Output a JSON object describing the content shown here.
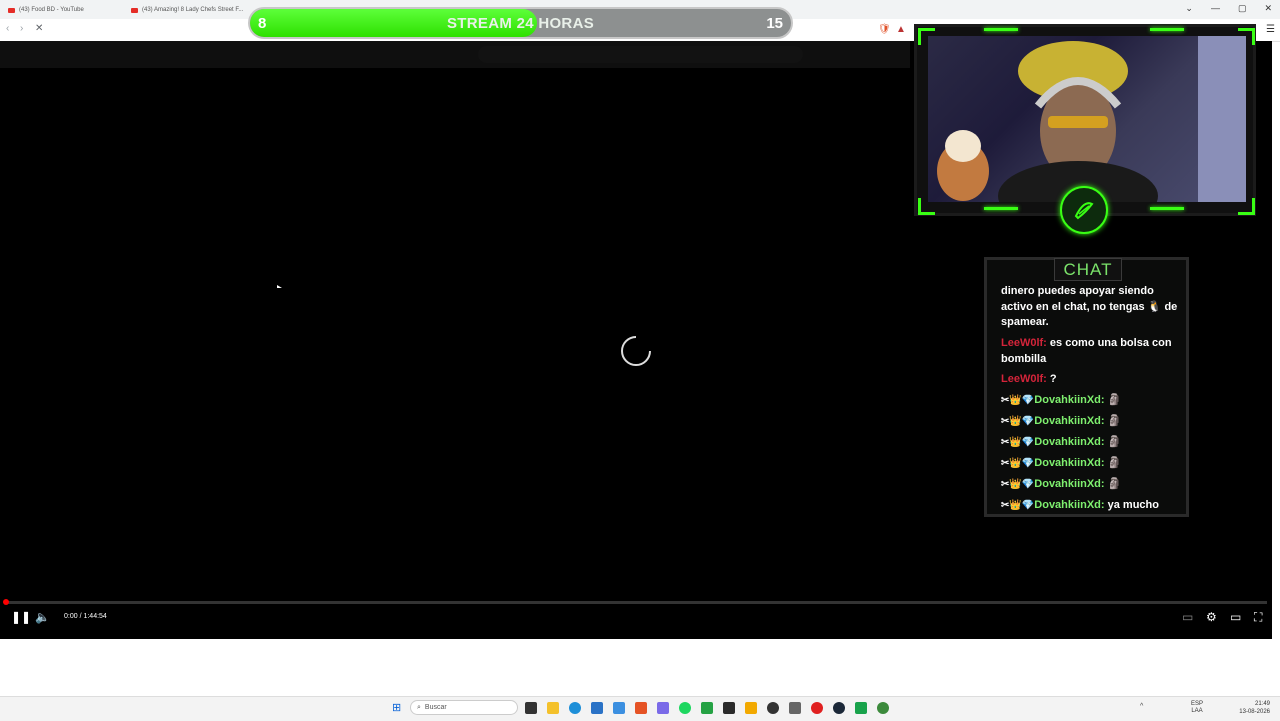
{
  "browser": {
    "tabs": [
      "(43) Food BD - YouTube",
      "(43) Amazing! 8 Lady Chefs Street F..."
    ],
    "window_controls": [
      "⌄",
      "—",
      "▢",
      "✕"
    ]
  },
  "stream_bar": {
    "left_number": "8",
    "title": "STREAM 24 HORAS",
    "right_number": "15",
    "progress_fraction": 0.53
  },
  "chat": {
    "header": "CHAT",
    "messages": [
      {
        "user": "",
        "text": "dinero puedes apoyar siendo activo en el chat, no tengas 🐧 de spamear."
      },
      {
        "user": "LeeW0lf:",
        "text": "es como una bolsa con bombilla",
        "color": "red"
      },
      {
        "user": "LeeW0lf:",
        "text": "?",
        "color": "red"
      },
      {
        "user": "DovahkiinXd:",
        "badges": "✂👑💎",
        "text": "🗿",
        "color": "green"
      },
      {
        "user": "DovahkiinXd:",
        "badges": "✂👑💎",
        "text": "🗿",
        "color": "green"
      },
      {
        "user": "DovahkiinXd:",
        "badges": "✂👑💎",
        "text": "🗿",
        "color": "green"
      },
      {
        "user": "DovahkiinXd:",
        "badges": "✂👑💎",
        "text": "🗿",
        "color": "green"
      },
      {
        "user": "DovahkiinXd:",
        "badges": "✂👑💎",
        "text": "🗿",
        "color": "green"
      },
      {
        "user": "DovahkiinXd:",
        "badges": "✂👑💎",
        "text": "ya mucho",
        "color": "green"
      }
    ]
  },
  "player": {
    "time": "0:00 / 1:44:54",
    "progress_fraction": 0.0
  },
  "taskbar": {
    "search_placeholder": "Buscar",
    "lang_top": "ESP",
    "lang_bottom": "LAA",
    "time": "21:49",
    "date": "13-08-2026"
  },
  "colors": {
    "accent_green": "#39ff14",
    "chat_red": "#d4243a",
    "chat_green": "#7ff06f",
    "progress_red": "#ff0000"
  }
}
